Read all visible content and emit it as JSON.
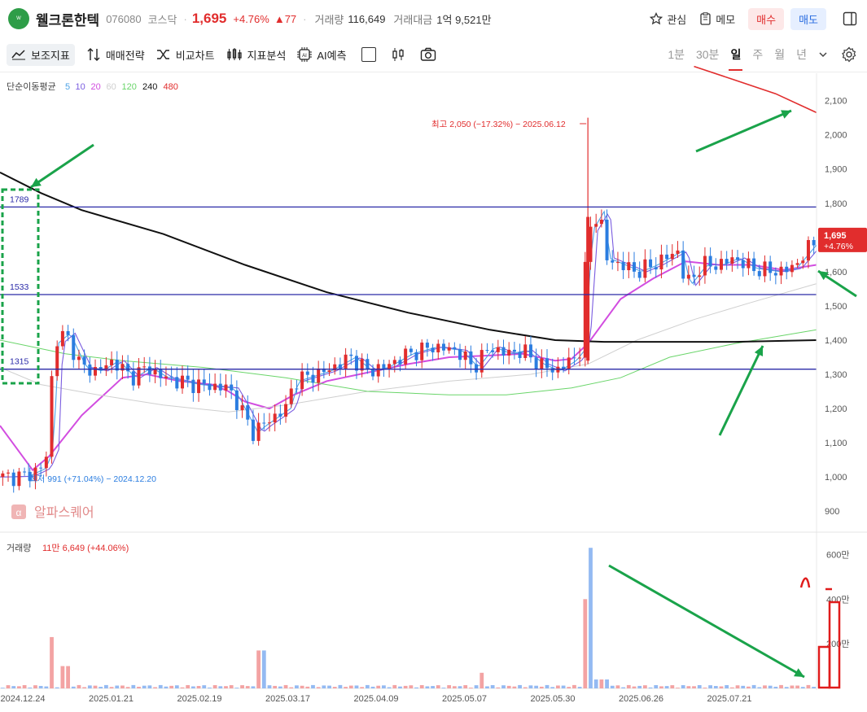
{
  "stock": {
    "name": "웰크론한텍",
    "code": "076080",
    "market": "코스닥",
    "price": "1,695",
    "change_pct": "+4.76%",
    "change_amt": "▲77",
    "volume_label": "거래량",
    "volume": "116,649",
    "value_label": "거래대금",
    "value": "1억 9,521만"
  },
  "header_actions": {
    "watch": "관심",
    "memo": "메모",
    "buy": "매수",
    "sell": "매도"
  },
  "toolbar": {
    "tools": [
      "보조지표",
      "매매전략",
      "비교차트",
      "지표분석",
      "AI예측"
    ],
    "periods": [
      "1분",
      "30분",
      "일",
      "주",
      "월",
      "년"
    ],
    "active_period": "일"
  },
  "colors": {
    "up": "#e12d2d",
    "down": "#2b7de0",
    "level": "#2a2aa8",
    "annotation": "#1aa34a"
  },
  "chart_data": {
    "type": "candlestick",
    "ma_label": "단순이동평균",
    "ma_periods": [
      {
        "name": "5",
        "color": "#4ea3e6"
      },
      {
        "name": "10",
        "color": "#7a5ce0"
      },
      {
        "name": "20",
        "color": "#d24de0"
      },
      {
        "name": "60",
        "color": "#cfcfcf"
      },
      {
        "name": "120",
        "color": "#6ad56a"
      },
      {
        "name": "240",
        "color": "#111111"
      },
      {
        "name": "480",
        "color": "#e12d2d"
      }
    ],
    "ylim": [
      860,
      2180
    ],
    "yticks": [
      "2,100",
      "2,000",
      "1,900",
      "1,800",
      "1,700",
      "1,600",
      "1,500",
      "1,400",
      "1,300",
      "1,200",
      "1,100",
      "1,000",
      "900"
    ],
    "ytick_values": [
      2100,
      2000,
      1900,
      1800,
      1700,
      1600,
      1500,
      1400,
      1300,
      1200,
      1100,
      1000,
      900
    ],
    "x_dates": [
      "2024.12.24",
      "2025.01.21",
      "2025.02.19",
      "2025.03.17",
      "2025.04.09",
      "2025.05.07",
      "2025.05.30",
      "2025.06.26",
      "2025.07.21"
    ],
    "levels": [
      {
        "label": "1789",
        "value": 1789
      },
      {
        "label": "1533",
        "value": 1533
      },
      {
        "label": "1315",
        "value": 1315
      }
    ],
    "high_annotation": "최고 2,050 (−17.32%) − 2025.06.12",
    "high_value": 2050,
    "low_annotation": "최저 991 (+71.04%) − 2024.12.20",
    "low_value": 991,
    "price_tag": {
      "price": "1,695",
      "pct": "+4.76%",
      "value": 1695
    },
    "volume_label": "거래량",
    "volume_value": "11만 6,649 (+44.06%)",
    "volume_ticks": [
      "600만",
      "400만",
      "200만"
    ],
    "volume_tick_values": [
      6000000,
      4000000,
      2000000
    ],
    "volume_max": 6600000,
    "watermark": "알파스퀘어",
    "close_path": [
      [
        0,
        1000
      ],
      [
        0.03,
        1002
      ],
      [
        0.05,
        1025
      ],
      [
        0.06,
        1080
      ],
      [
        0.065,
        1390
      ],
      [
        0.08,
        1420
      ],
      [
        0.1,
        1320
      ],
      [
        0.12,
        1310
      ],
      [
        0.14,
        1340
      ],
      [
        0.16,
        1290
      ],
      [
        0.18,
        1320
      ],
      [
        0.2,
        1290
      ],
      [
        0.24,
        1270
      ],
      [
        0.28,
        1260
      ],
      [
        0.29,
        1220
      ],
      [
        0.31,
        1130
      ],
      [
        0.32,
        1150
      ],
      [
        0.35,
        1200
      ],
      [
        0.36,
        1280
      ],
      [
        0.4,
        1310
      ],
      [
        0.43,
        1350
      ],
      [
        0.45,
        1310
      ],
      [
        0.47,
        1320
      ],
      [
        0.5,
        1360
      ],
      [
        0.53,
        1380
      ],
      [
        0.56,
        1370
      ],
      [
        0.58,
        1320
      ],
      [
        0.6,
        1380
      ],
      [
        0.62,
        1360
      ],
      [
        0.64,
        1370
      ],
      [
        0.66,
        1330
      ],
      [
        0.68,
        1310
      ],
      [
        0.7,
        1340
      ],
      [
        0.71,
        1370
      ],
      [
        0.72,
        1720
      ],
      [
        0.735,
        1780
      ],
      [
        0.74,
        1640
      ],
      [
        0.76,
        1620
      ],
      [
        0.78,
        1600
      ],
      [
        0.8,
        1620
      ],
      [
        0.83,
        1660
      ],
      [
        0.84,
        1560
      ],
      [
        0.86,
        1620
      ],
      [
        0.88,
        1620
      ],
      [
        0.9,
        1640
      ],
      [
        0.92,
        1610
      ],
      [
        0.95,
        1600
      ],
      [
        0.97,
        1610
      ],
      [
        1,
        1695
      ]
    ],
    "ma_paths": {
      "20": [
        [
          0,
          1150
        ],
        [
          0.04,
          1020
        ],
        [
          0.06,
          1060
        ],
        [
          0.1,
          1180
        ],
        [
          0.15,
          1290
        ],
        [
          0.18,
          1300
        ],
        [
          0.22,
          1280
        ],
        [
          0.26,
          1270
        ],
        [
          0.28,
          1250
        ],
        [
          0.3,
          1220
        ],
        [
          0.33,
          1200
        ],
        [
          0.36,
          1240
        ],
        [
          0.4,
          1280
        ],
        [
          0.44,
          1300
        ],
        [
          0.5,
          1330
        ],
        [
          0.55,
          1350
        ],
        [
          0.6,
          1355
        ],
        [
          0.64,
          1360
        ],
        [
          0.68,
          1340
        ],
        [
          0.7,
          1345
        ],
        [
          0.72,
          1390
        ],
        [
          0.76,
          1520
        ],
        [
          0.8,
          1580
        ],
        [
          0.84,
          1630
        ],
        [
          0.88,
          1620
        ],
        [
          0.92,
          1620
        ],
        [
          0.96,
          1605
        ],
        [
          1,
          1620
        ]
      ],
      "60": [
        [
          0,
          1320
        ],
        [
          0.05,
          1270
        ],
        [
          0.12,
          1240
        ],
        [
          0.2,
          1210
        ],
        [
          0.28,
          1190
        ],
        [
          0.35,
          1210
        ],
        [
          0.45,
          1250
        ],
        [
          0.55,
          1280
        ],
        [
          0.65,
          1300
        ],
        [
          0.72,
          1330
        ],
        [
          0.78,
          1400
        ],
        [
          0.85,
          1460
        ],
        [
          0.92,
          1510
        ],
        [
          1,
          1565
        ]
      ],
      "120": [
        [
          0,
          1400
        ],
        [
          0.08,
          1360
        ],
        [
          0.15,
          1340
        ],
        [
          0.25,
          1320
        ],
        [
          0.35,
          1290
        ],
        [
          0.45,
          1250
        ],
        [
          0.55,
          1240
        ],
        [
          0.62,
          1240
        ],
        [
          0.7,
          1260
        ],
        [
          0.76,
          1290
        ],
        [
          0.82,
          1350
        ],
        [
          0.9,
          1390
        ],
        [
          1,
          1430
        ]
      ],
      "240": [
        [
          0,
          1890
        ],
        [
          0.05,
          1830
        ],
        [
          0.1,
          1780
        ],
        [
          0.2,
          1710
        ],
        [
          0.3,
          1620
        ],
        [
          0.4,
          1540
        ],
        [
          0.5,
          1480
        ],
        [
          0.6,
          1430
        ],
        [
          0.68,
          1400
        ],
        [
          0.74,
          1395
        ],
        [
          0.8,
          1395
        ],
        [
          0.9,
          1395
        ],
        [
          1,
          1400
        ]
      ],
      "480": [
        [
          0.85,
          2200
        ],
        [
          0.9,
          2160
        ],
        [
          0.95,
          2120
        ],
        [
          1,
          2065
        ]
      ]
    }
  }
}
